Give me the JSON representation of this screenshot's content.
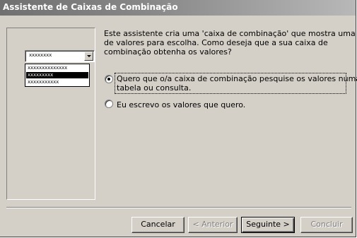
{
  "window": {
    "title": "Assistente de Caixas de Combinação"
  },
  "illustration": {
    "combo_value": "xxxxxxxx",
    "list_items": [
      {
        "text": "xxxxxxxxxxxxxx",
        "selected": false
      },
      {
        "text": "xxxxxxxxx",
        "selected": true
      },
      {
        "text": "xxxxxxxxxxx",
        "selected": false
      }
    ]
  },
  "intro": {
    "line1": "Este assistente cria uma 'caixa de combinação' que mostra uma lista",
    "line2": "de valores para escolha. Como deseja que a sua caixa de",
    "line3": "combinação obtenha os valores?"
  },
  "options": [
    {
      "line1": "Quero que o/a caixa de combinação pesquise os valores numa",
      "line2": "tabela ou consulta.",
      "checked": true
    },
    {
      "line1": "Eu escrevo os valores que quero.",
      "line2": "",
      "checked": false
    }
  ],
  "buttons": {
    "cancel": "Cancelar",
    "back": "< Anterior",
    "next": "Seguinte >",
    "finish": "Concluir"
  }
}
